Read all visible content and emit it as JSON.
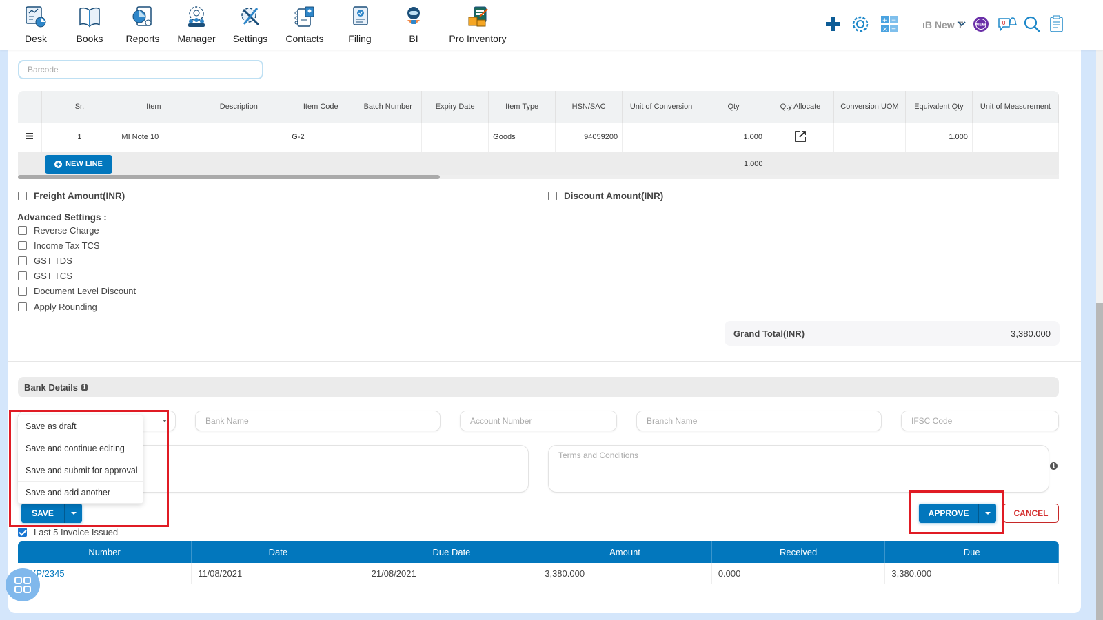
{
  "nav": {
    "items": [
      {
        "label": "Desk",
        "icon": "desk-icon"
      },
      {
        "label": "Books",
        "icon": "books-icon"
      },
      {
        "label": "Reports",
        "icon": "reports-icon"
      },
      {
        "label": "Manager",
        "icon": "manager-icon"
      },
      {
        "label": "Settings",
        "icon": "settings-icon"
      },
      {
        "label": "Contacts",
        "icon": "contacts-icon"
      },
      {
        "label": "Filing",
        "icon": "filing-icon"
      },
      {
        "label": "BI",
        "icon": "bi-robot-icon"
      },
      {
        "label": "Pro Inventory",
        "icon": "pro-inventory-icon"
      }
    ],
    "company": "ıB New T",
    "notification_count": "0",
    "new_badge": "NEW"
  },
  "barcode": {
    "placeholder": "Barcode"
  },
  "items_table": {
    "columns": [
      "",
      "Sr.",
      "Item",
      "Description",
      "Item Code",
      "Batch Number",
      "Expiry Date",
      "Item Type",
      "HSN/SAC",
      "Unit of Conversion",
      "Qty",
      "Qty Allocate",
      "Conversion UOM",
      "Equivalent Qty",
      "Unit of Measurement"
    ],
    "rows": [
      {
        "sr": "1",
        "item": "MI Note 10",
        "description": "",
        "item_code": "G-2",
        "batch_number": "",
        "expiry_date": "",
        "item_type": "Goods",
        "hsn_sac": "94059200",
        "unit_of_conversion": "",
        "qty": "1.000",
        "conversion_uom": "",
        "equivalent_qty": "1.000",
        "uom": ""
      }
    ],
    "total_qty": "1.000",
    "new_line_label": "NEW LINE"
  },
  "charges": {
    "freight": "Freight Amount(INR)",
    "discount": "Discount Amount(INR)"
  },
  "advanced": {
    "title": "Advanced Settings :",
    "options": [
      {
        "label": "Reverse Charge",
        "checked": false
      },
      {
        "label": "Income Tax TCS",
        "checked": false
      },
      {
        "label": "GST TDS",
        "checked": false
      },
      {
        "label": "GST TCS",
        "checked": false
      },
      {
        "label": "Document Level Discount",
        "checked": false
      },
      {
        "label": "Apply Rounding",
        "checked": false
      }
    ]
  },
  "grand_total": {
    "label": "Grand Total(INR)",
    "value": "3,380.000"
  },
  "bank": {
    "title": "Bank Details",
    "bank_name_placeholder": "Bank Name",
    "account_number_placeholder": "Account Number",
    "branch_name_placeholder": "Branch Name",
    "ifsc_placeholder": "IFSC Code",
    "terms_placeholder": "Terms and Conditions"
  },
  "save_menu": {
    "options": [
      "Save as draft",
      "Save and continue editing",
      "Save and submit for approval",
      "Save and add another"
    ],
    "save_label": "SAVE"
  },
  "actions": {
    "approve_label": "APPROVE",
    "cancel_label": "CANCEL"
  },
  "last_invoices": {
    "label": "Last 5 Invoice Issued",
    "checked": true,
    "columns": [
      "Number",
      "Date",
      "Due Date",
      "Amount",
      "Received",
      "Due"
    ],
    "rows": [
      {
        "number": "EXP/2345",
        "date": "11/08/2021",
        "due_date": "21/08/2021",
        "amount": "3,380.000",
        "received": "0.000",
        "due": "3,380.000"
      }
    ]
  },
  "colors": {
    "primary": "#0277bd",
    "cancel": "#d32f2f",
    "highlight": "#e01b24",
    "background": "#d4e6fb"
  }
}
